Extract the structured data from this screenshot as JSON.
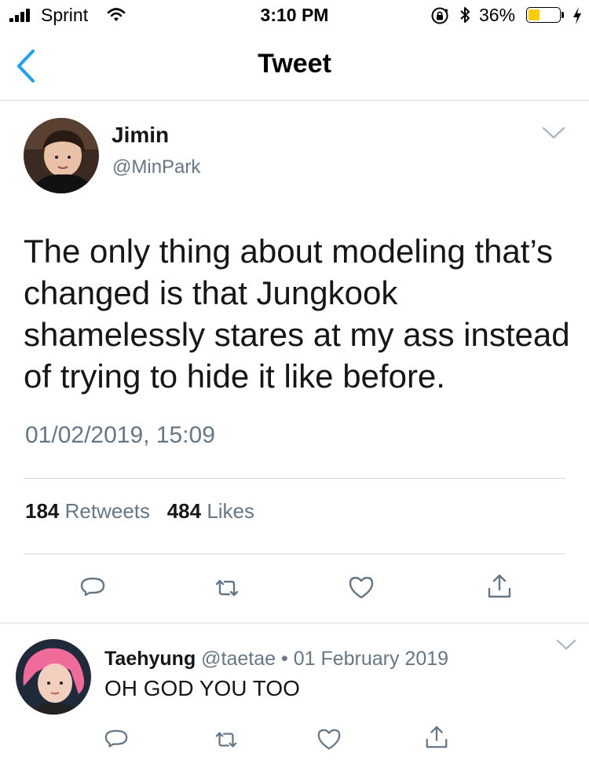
{
  "status_bar": {
    "carrier": "Sprint",
    "time": "3:10 PM",
    "battery_percent": "36%",
    "battery_level": 0.36,
    "icons": [
      "signal-icon",
      "wifi-icon",
      "orientation-lock-icon",
      "bluetooth-icon",
      "battery-icon",
      "charging-icon"
    ]
  },
  "nav": {
    "title": "Tweet",
    "back_icon": "back-chevron-icon"
  },
  "tweet": {
    "author_name": "Jimin",
    "author_handle": "@MinPark",
    "text": "The only thing about modeling that’s changed is that Jungkook shamelessly stares at my ass instead of trying to hide it  like before.",
    "timestamp": "01/02/2019, 15:09",
    "retweet_count": "184",
    "retweet_label": "Retweets",
    "like_count": "484",
    "like_label": "Likes",
    "actions": [
      "reply-icon",
      "retweet-icon",
      "like-icon",
      "share-icon"
    ]
  },
  "reply": {
    "author_name": "Taehyung",
    "meta": "@taetae • 01 February 2019",
    "text": "OH GOD YOU TOO",
    "actions": [
      "reply-icon",
      "retweet-icon",
      "like-icon",
      "share-icon"
    ]
  },
  "colors": {
    "accent_blue": "#1da1f2",
    "text_primary": "#14171a",
    "text_secondary": "#657786",
    "divider": "#d6d9dc",
    "icon_gray": "#657786",
    "battery_fill": "#ffcc00"
  }
}
